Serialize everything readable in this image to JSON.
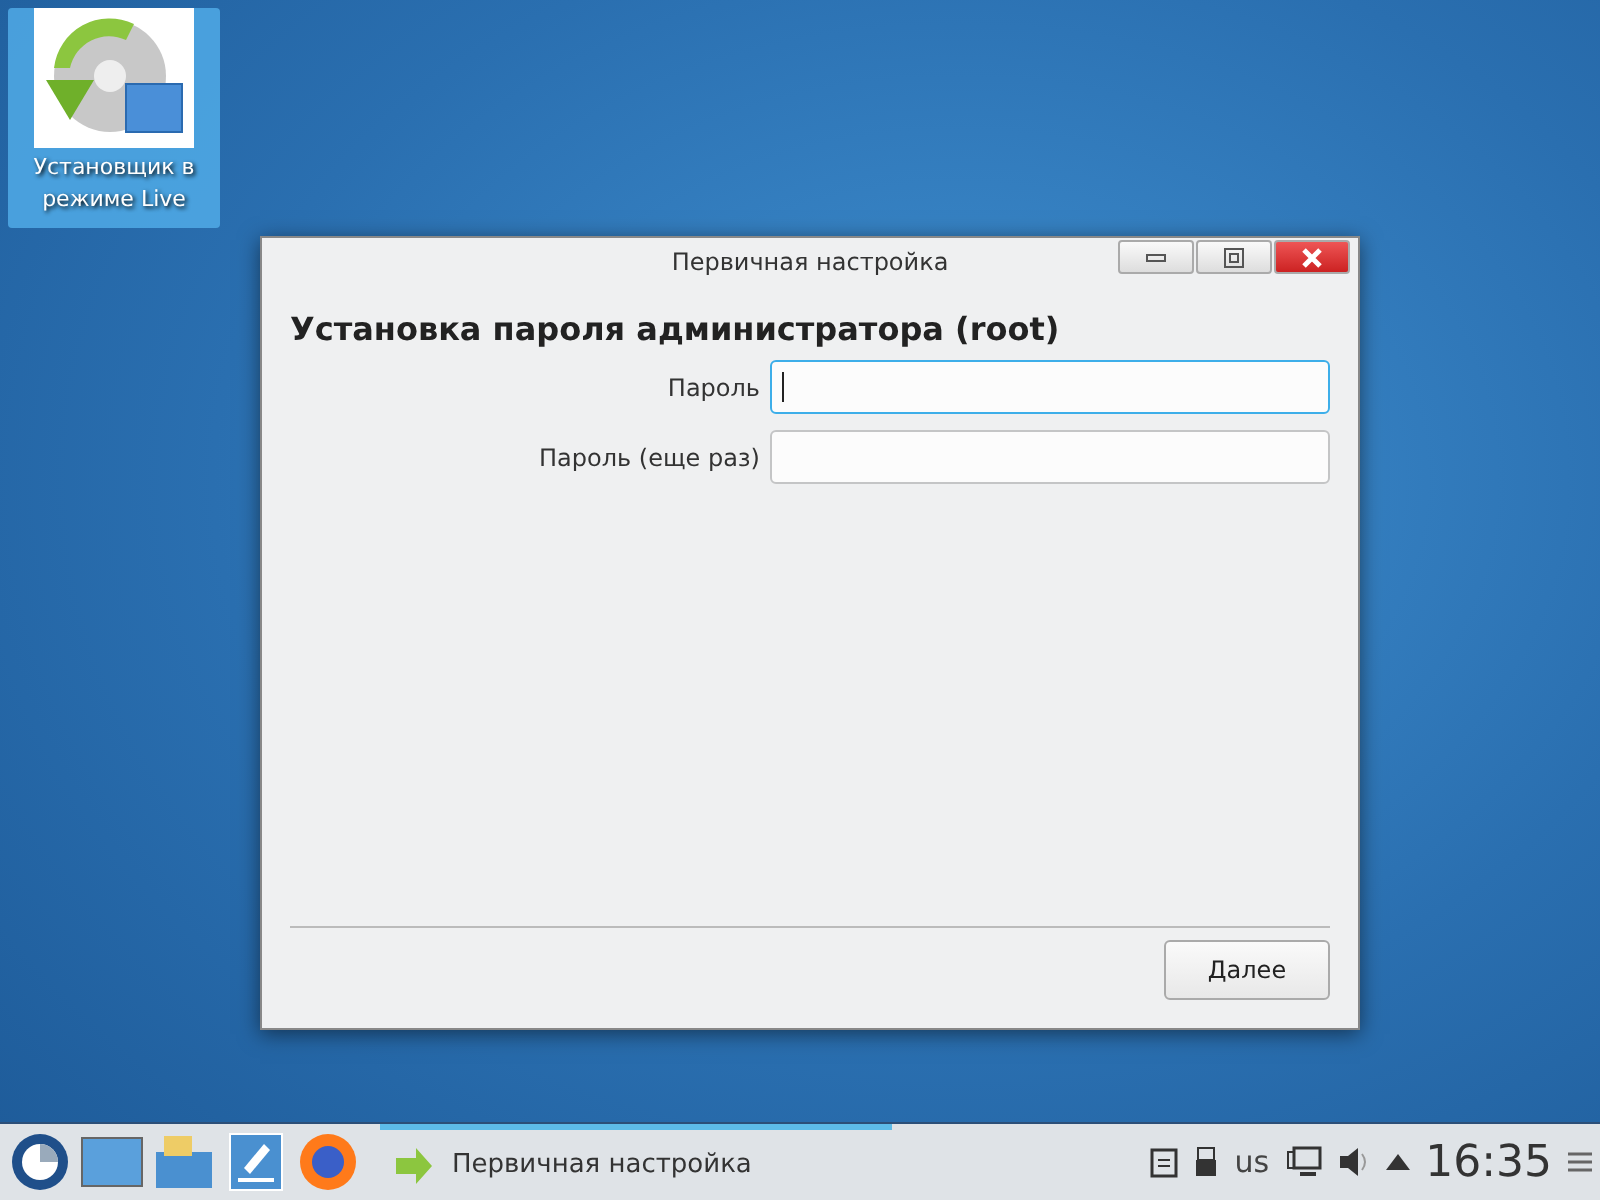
{
  "desktop_icons": [
    {
      "label": "Установщик в режиме Live",
      "selected": true
    }
  ],
  "window": {
    "title": "Первичная настройка",
    "heading": "Установка пароля администратора (root)",
    "fields": [
      {
        "label": "Пароль",
        "focused": true
      },
      {
        "label": "Пароль (еще раз)",
        "focused": false
      }
    ],
    "buttons": [
      "Далее"
    ]
  },
  "taskbar": {
    "tasks": [
      {
        "label": "Первичная настройка",
        "selected": true
      }
    ],
    "keyboard_layout": "us",
    "clock": "16:35"
  }
}
